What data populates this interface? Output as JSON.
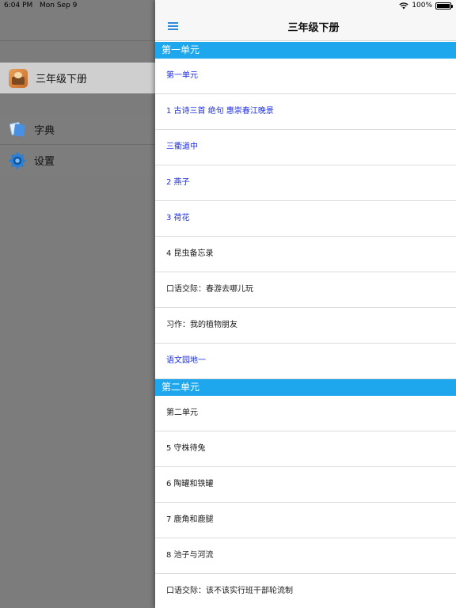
{
  "status_bar": {
    "time": "6:04 PM",
    "date": "Mon Sep 9",
    "battery": "100%",
    "battery_level": 1.0
  },
  "drawer": {
    "book": {
      "label": "三年级下册"
    },
    "items": [
      {
        "label": "字典",
        "icon": "dictionary-icon"
      },
      {
        "label": "设置",
        "icon": "gear-icon"
      }
    ]
  },
  "navbar": {
    "title": "三年级下册",
    "menu_icon": "hamburger-menu-icon"
  },
  "colors": {
    "accent": "#1ea7ec",
    "link_blue": "#1d2ee0",
    "drawer_bg": "#7c7c7c",
    "selected_bg": "#cfcfcf"
  },
  "sections": [
    {
      "title": "第一单元",
      "rows": [
        {
          "text": "第一单元",
          "style": "blue"
        },
        {
          "text": "1 古诗三首  绝句  惠崇春江晚景",
          "style": "blue"
        },
        {
          "text": " 三衢道中",
          "style": "blue"
        },
        {
          "text": "2 燕子",
          "style": "blue"
        },
        {
          "text": "3 荷花",
          "style": "blue"
        },
        {
          "text": "4 昆虫备忘录",
          "style": "black"
        },
        {
          "text": "口语交际：春游去哪儿玩",
          "style": "black"
        },
        {
          "text": "习作：我的植物朋友",
          "style": "black"
        },
        {
          "text": "语文园地一",
          "style": "blue"
        }
      ]
    },
    {
      "title": "第二单元",
      "rows": [
        {
          "text": "第二单元",
          "style": "black"
        },
        {
          "text": "5 守株待兔",
          "style": "black"
        },
        {
          "text": "6 陶罐和铁罐",
          "style": "black"
        },
        {
          "text": "7 鹿角和鹿腿",
          "style": "black"
        },
        {
          "text": "8 池子与河流",
          "style": "black"
        },
        {
          "text": "口语交际：该不该实行班干部轮流制",
          "style": "black"
        }
      ]
    }
  ]
}
